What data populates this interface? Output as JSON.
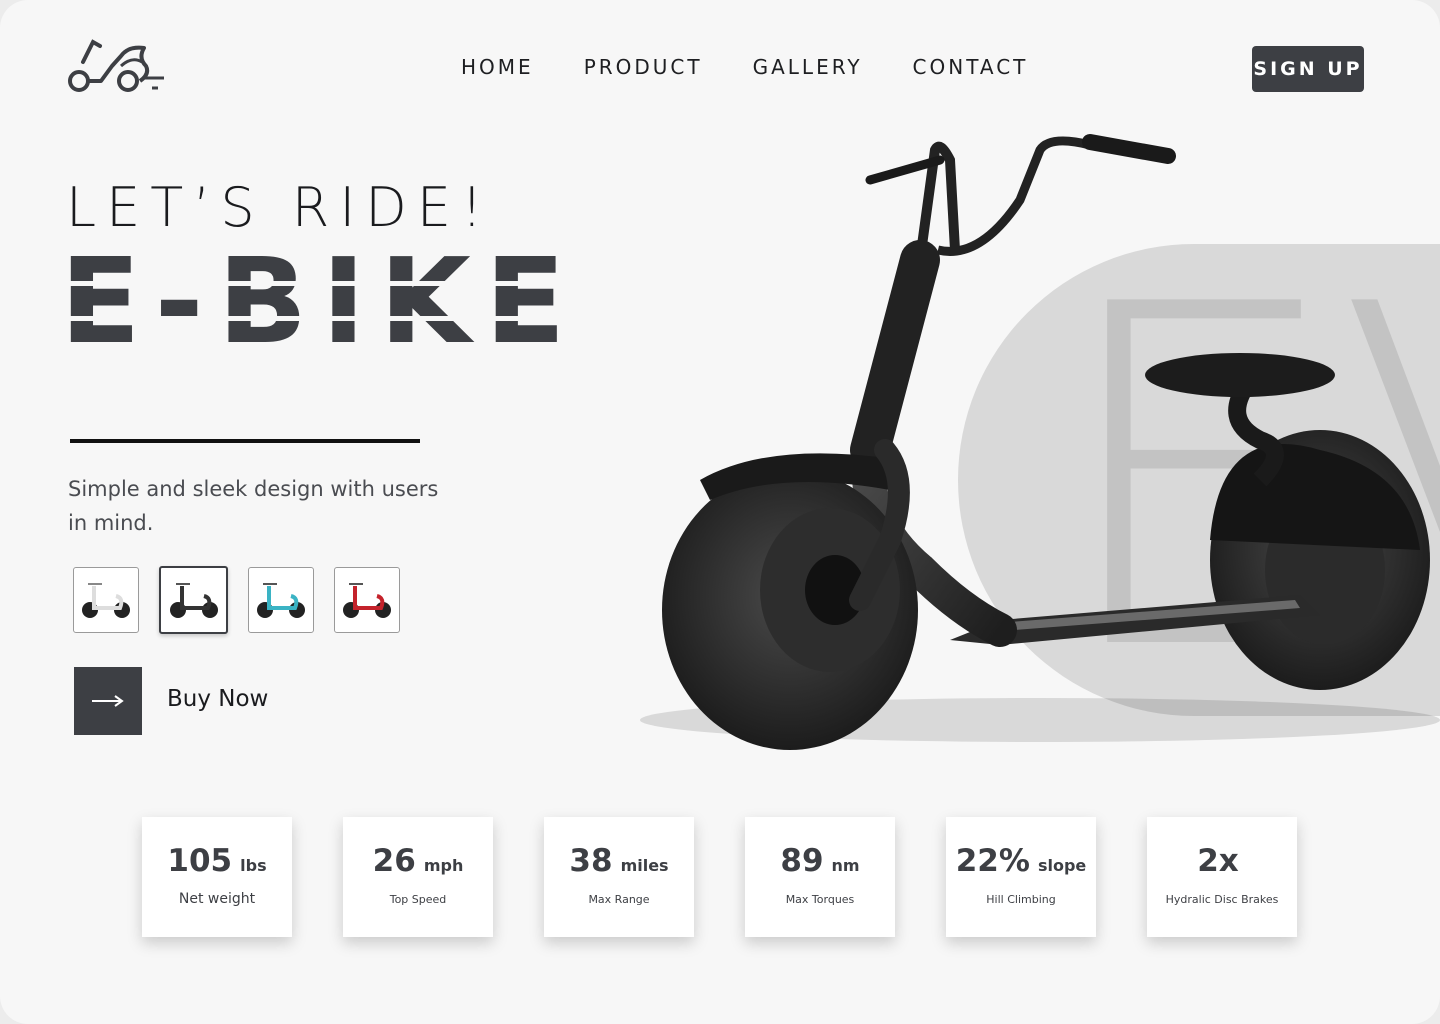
{
  "nav": {
    "items": [
      {
        "label": "HOME"
      },
      {
        "label": "PRODUCT"
      },
      {
        "label": "GALLERY"
      },
      {
        "label": "CONTACT"
      }
    ],
    "signup_label": "SIGN UP"
  },
  "hero": {
    "tagline": "LET’S RIDE!",
    "title": "E-BIKE",
    "description": "Simple and sleek design with users in mind.",
    "buy_label": "Buy Now",
    "background_text": "EV",
    "color_options": [
      {
        "name": "white",
        "accent": "#e8e8e8",
        "selected": false
      },
      {
        "name": "black",
        "accent": "#2a2a2a",
        "selected": true
      },
      {
        "name": "teal",
        "accent": "#3ab3c4",
        "selected": false
      },
      {
        "name": "red",
        "accent": "#c4222b",
        "selected": false
      }
    ]
  },
  "stats": [
    {
      "value": "105",
      "unit": "lbs",
      "label": "Net weight"
    },
    {
      "value": "26",
      "unit": "mph",
      "label": "Top Speed"
    },
    {
      "value": "38",
      "unit": "miles",
      "label": "Max Range"
    },
    {
      "value": "89",
      "unit": "nm",
      "label": "Max Torques"
    },
    {
      "value": "22%",
      "unit": "slope",
      "label": "Hill Climbing"
    },
    {
      "value": "2x",
      "unit": "",
      "label": "Hydralic Disc Brakes"
    }
  ],
  "colors": {
    "primary": "#3d3f44",
    "background": "#f7f7f7",
    "circle": "#d9d9d9"
  }
}
